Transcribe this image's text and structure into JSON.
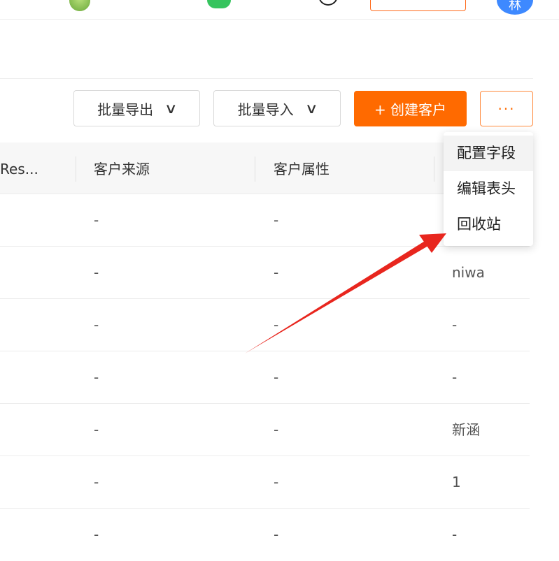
{
  "header": {
    "avatar_letter": "林"
  },
  "toolbar": {
    "export_label": "批量导出",
    "import_label": "批量导入",
    "create_label": "+ 创建客户",
    "more_label": "···",
    "chevron": "∨"
  },
  "table": {
    "columns": [
      "Res...",
      "客户来源",
      "客户属性"
    ],
    "rows": [
      {
        "source": "-",
        "attr": "-",
        "extra": ""
      },
      {
        "source": "-",
        "attr": "-",
        "extra": "niwa"
      },
      {
        "source": "-",
        "attr": "-",
        "extra": "-"
      },
      {
        "source": "-",
        "attr": "-",
        "extra": "-"
      },
      {
        "source": "-",
        "attr": "-",
        "extra": "新涵"
      },
      {
        "source": "-",
        "attr": "-",
        "extra": "1"
      },
      {
        "source": "-",
        "attr": "-",
        "extra": "-"
      }
    ]
  },
  "more_menu": {
    "items": [
      "配置字段",
      "编辑表头",
      "回收站"
    ]
  },
  "colors": {
    "accent": "#ff6a00",
    "annotation_arrow": "#e8261e"
  }
}
